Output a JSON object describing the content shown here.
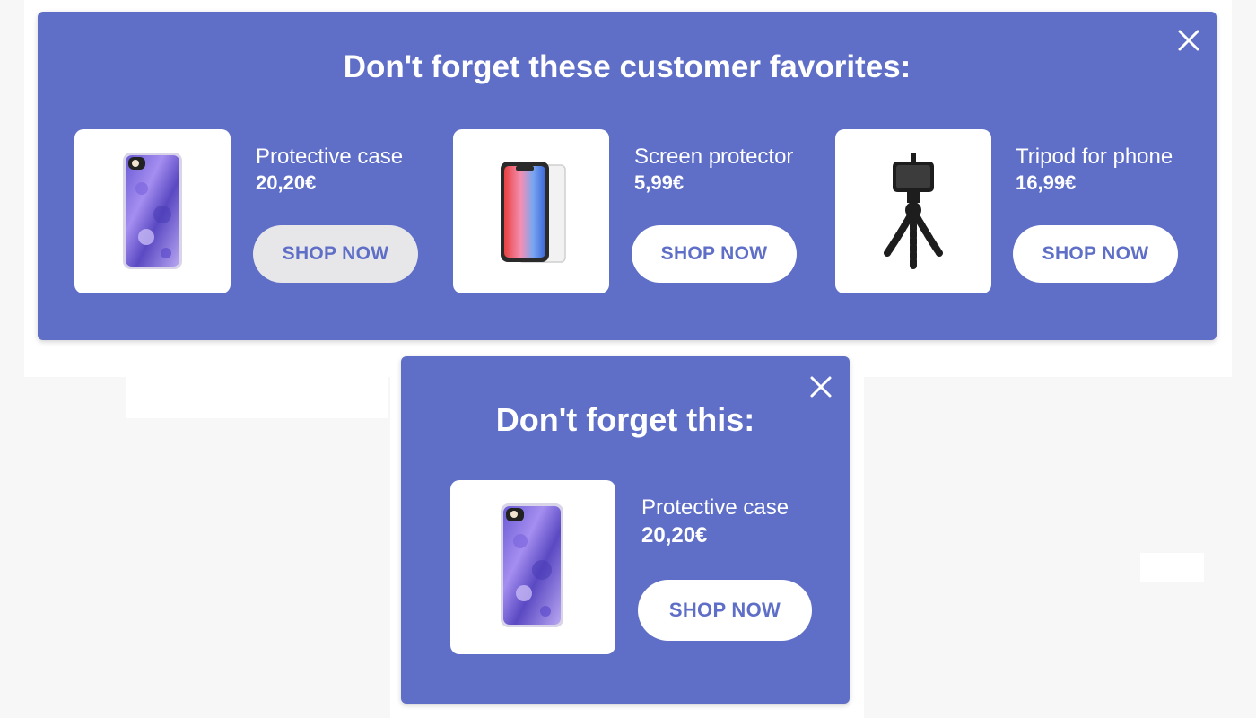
{
  "colors": {
    "popup_background": "#5f6fc7",
    "button_text": "#5f6fc7",
    "button_background": "#ffffff",
    "button_hover_background": "#e7e7e9",
    "page_background": "#f7f7f7"
  },
  "multi_popup": {
    "title": "Don't forget these customer favorites:",
    "close_icon": "close-icon",
    "products": [
      {
        "name": "Protective case",
        "price": "20,20€",
        "button_label": "SHOP NOW",
        "button_state": "hover",
        "image": "phone-case-image"
      },
      {
        "name": "Screen protector",
        "price": "5,99€",
        "button_label": "SHOP NOW",
        "button_state": "default",
        "image": "screen-protector-image"
      },
      {
        "name": "Tripod for phone",
        "price": "16,99€",
        "button_label": "SHOP NOW",
        "button_state": "default",
        "image": "tripod-image"
      }
    ]
  },
  "single_popup": {
    "title": "Don't forget this:",
    "close_icon": "close-icon",
    "product": {
      "name": "Protective case",
      "price": "20,20€",
      "button_label": "SHOP NOW",
      "image": "phone-case-image"
    }
  }
}
